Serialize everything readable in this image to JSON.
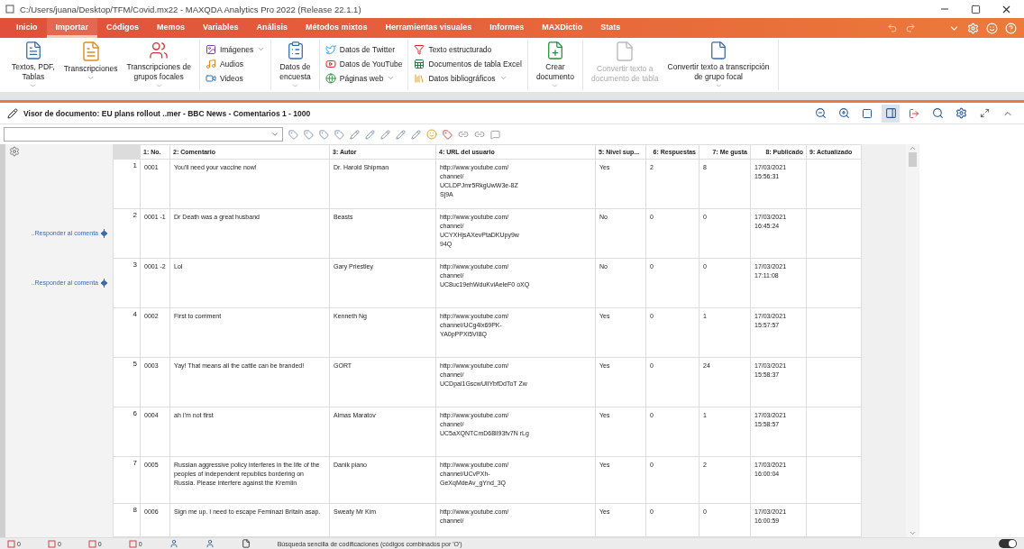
{
  "window": {
    "title": "C:/Users/juana/Desktop/TFM/Covid.mx22 - MAXQDA Analytics Pro 2022 (Release 22.1.1)"
  },
  "ribbon_tabs": [
    {
      "label": "Inicio",
      "selected": false
    },
    {
      "label": "Importar",
      "selected": true
    },
    {
      "label": "Códigos",
      "selected": false
    },
    {
      "label": "Memos",
      "selected": false
    },
    {
      "label": "Variables",
      "selected": false
    },
    {
      "label": "Análisis",
      "selected": false
    },
    {
      "label": "Métodos mixtos",
      "selected": false
    },
    {
      "label": "Herramientas visuales",
      "selected": false
    },
    {
      "label": "Informes",
      "selected": false
    },
    {
      "label": "MAXDictio",
      "selected": false
    },
    {
      "label": "Stats",
      "selected": false
    }
  ],
  "ribbon_groups": [
    {
      "kind": "large",
      "items": [
        {
          "label": "Textos, PDF,\nTablas",
          "has_menu": true,
          "disabled": false
        },
        {
          "label": "Transcripciones",
          "has_menu": true,
          "disabled": false
        },
        {
          "label": "Transcripciones de\ngrupos focales",
          "has_menu": true,
          "disabled": false
        }
      ]
    },
    {
      "kind": "small",
      "items": [
        {
          "label": "Imágenes",
          "has_menu": true,
          "disabled": false
        },
        {
          "label": "Audios",
          "has_menu": false,
          "disabled": false
        },
        {
          "label": "Videos",
          "has_menu": false,
          "disabled": false
        }
      ]
    },
    {
      "kind": "large",
      "items": [
        {
          "label": "Datos de\nencuesta",
          "has_menu": true,
          "disabled": false
        }
      ]
    },
    {
      "kind": "small",
      "items": [
        {
          "label": "Datos de Twitter",
          "has_menu": false,
          "disabled": false
        },
        {
          "label": "Datos de YouTube",
          "has_menu": false,
          "disabled": false
        },
        {
          "label": "Páginas web",
          "has_menu": true,
          "disabled": false
        }
      ]
    },
    {
      "kind": "small",
      "items": [
        {
          "label": "Texto estructurado",
          "has_menu": false,
          "disabled": false
        },
        {
          "label": "Documentos de tabla Excel",
          "has_menu": false,
          "disabled": false
        },
        {
          "label": "Datos bibliográficos",
          "has_menu": true,
          "disabled": false
        }
      ]
    },
    {
      "kind": "large",
      "items": [
        {
          "label": "Crear\ndocumento",
          "has_menu": true,
          "disabled": false
        }
      ]
    },
    {
      "kind": "large",
      "items": [
        {
          "label": "Convertir texto a\ndocumento de tabla",
          "has_menu": false,
          "disabled": true
        },
        {
          "label": "Convertir texto a transcripción\nde grupo focal",
          "has_menu": true,
          "disabled": false
        }
      ]
    }
  ],
  "document_viewer": {
    "title": "Visor de documento: EU plans rollout ..mer - BBC News -  Comentarios 1 - 1000"
  },
  "table": {
    "columns": [
      "1: No.",
      "2: Comentario",
      "3: Autor",
      "4: URL del usuario",
      "5: Nivel sup...",
      "6: Respuestas",
      "7: Me gusta",
      "8: Publicado",
      "9: Actualizado"
    ],
    "rows": [
      {
        "number": "1",
        "reply_label": null,
        "cells": [
          "0001",
          "You'll need your vaccine now!",
          "Dr. Harold Shipman",
          "http://www.youtube.com/ channel/ UCLDPJmr5RkgUwW3e-8Z Sj9A",
          "Yes",
          "2",
          "8",
          "17/03/2021 15:56:31",
          ""
        ]
      },
      {
        "number": "2",
        "reply_label": "..Responder al comenta",
        "cells": [
          "0001 -1",
          "Dr Death was a great husband",
          "Beasts",
          "http://www.youtube.com/ channel/ UCYXHjsAXevPtaDKUpy9w 94Q",
          "No",
          "0",
          "0",
          "17/03/2021 16:45:24",
          ""
        ]
      },
      {
        "number": "3",
        "reply_label": "..Responder al comenta",
        "cells": [
          "0001 -2",
          "Lol",
          "Gary Priestley",
          "http://www.youtube.com/ channel/ UC8uc19ehWduKviAeleF0 oXQ",
          "No",
          "0",
          "0",
          "17/03/2021 17:11:08",
          ""
        ]
      },
      {
        "number": "4",
        "reply_label": null,
        "cells": [
          "0002",
          "First to comment",
          "Kenneth Ng",
          "http://www.youtube.com/ channel/UCg4lx69PK- YA0pPPXi5VI8Q",
          "Yes",
          "0",
          "1",
          "17/03/2021 15:57:57",
          ""
        ]
      },
      {
        "number": "5",
        "reply_label": null,
        "cells": [
          "0003",
          "Yay! That means all the cattle can be branded!",
          "GORT",
          "http://www.youtube.com/ channel/ UCDpal1GscwUlIYbfDdToT Zw",
          "Yes",
          "0",
          "24",
          "17/03/2021 15:58:37",
          ""
        ]
      },
      {
        "number": "6",
        "reply_label": null,
        "cells": [
          "0004",
          "ah I'm not first",
          "Almas Maratov",
          "http://www.youtube.com/ channel/ UC5aXQNTCmD68lI93fv7N rLg",
          "Yes",
          "0",
          "1",
          "17/03/2021 15:58:57",
          ""
        ]
      },
      {
        "number": "7",
        "reply_label": null,
        "cells": [
          "0005",
          "Russian aggressive policy interferes in the life of the peoples of independent republics bordering on Russia. Please interfere against the Kremlin",
          "Danik piano",
          "http://www.youtube.com/ channel/UCvPXh- GeXqMdeAv_gYnd_3Q",
          "Yes",
          "0",
          "2",
          "17/03/2021 16:00:04",
          ""
        ]
      },
      {
        "number": "8",
        "reply_label": null,
        "cells": [
          "0006",
          "Sign me up. I need to escape Feminazi Britain asap.",
          "Sweaty Mr Kim",
          "http://www.youtube.com/ channel/",
          "Yes",
          "0",
          "0",
          "17/03/2021 16:00:59",
          ""
        ]
      }
    ]
  },
  "status_bar": {
    "counters": [
      "0",
      "0",
      "0",
      "0"
    ],
    "search_mode": "Búsqueda sencilla de codificaciones (códigos combinados por 'O')",
    "toggle_on": true
  }
}
